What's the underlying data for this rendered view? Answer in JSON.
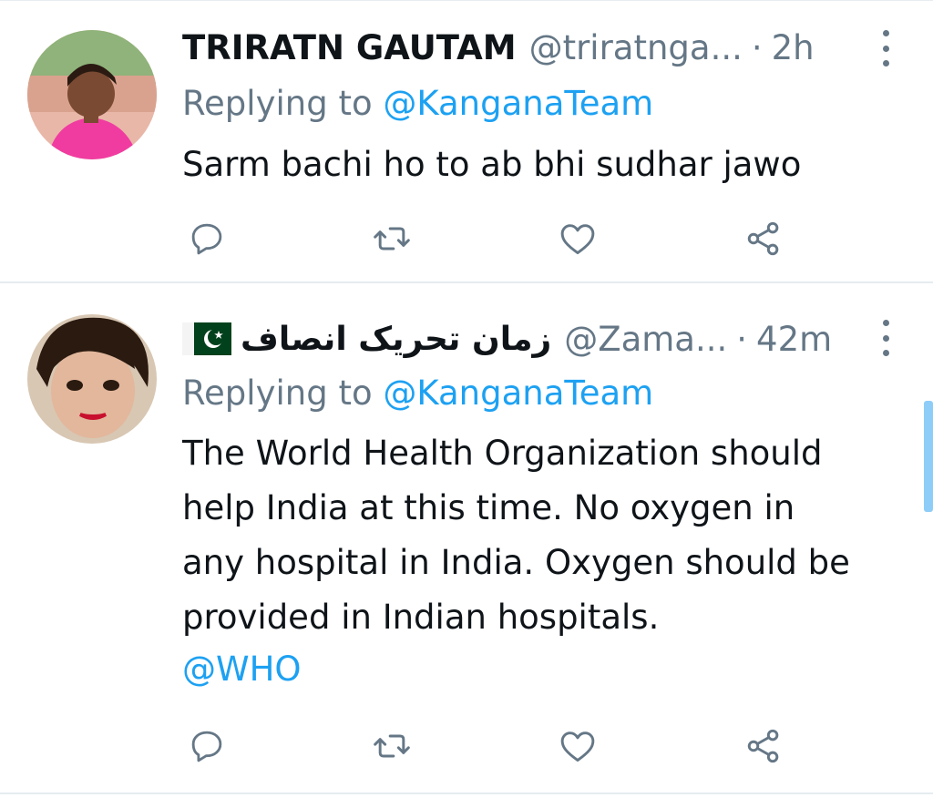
{
  "tweets": [
    {
      "name": "TRIRATN GAUTAM",
      "handle": "@triratnga...",
      "separator": "·",
      "time": "2h",
      "replying_prefix": "Replying to",
      "replying_to": "@KanganaTeam",
      "text_lines": [
        "Sarm bachi ho to ab bhi sudhar jawo"
      ],
      "mentions": [],
      "avatar": "male-person-pink-shirt-photo",
      "actions": [
        "reply-icon",
        "retweet-icon",
        "like-icon",
        "share-icon"
      ]
    },
    {
      "name": "زمان تحریک انصاف",
      "flag": "pakistan-flag-icon",
      "handle": "@Zama...",
      "separator": "·",
      "time": "42m",
      "replying_prefix": "Replying to",
      "replying_to": "@KanganaTeam",
      "text_lines": [
        "The World Health Organization should",
        "help India at this time. No oxygen in",
        "any hospital in India. Oxygen should be",
        "provided in Indian hospitals."
      ],
      "mentions": [
        "@WHO"
      ],
      "avatar": "child-face-photo",
      "actions": [
        "reply-icon",
        "retweet-icon",
        "like-icon",
        "share-icon"
      ]
    }
  ],
  "colors": {
    "accent": "#1da1f2",
    "text": "#0f1419",
    "secondary_text": "#657786",
    "divider": "#e6ecf0"
  }
}
